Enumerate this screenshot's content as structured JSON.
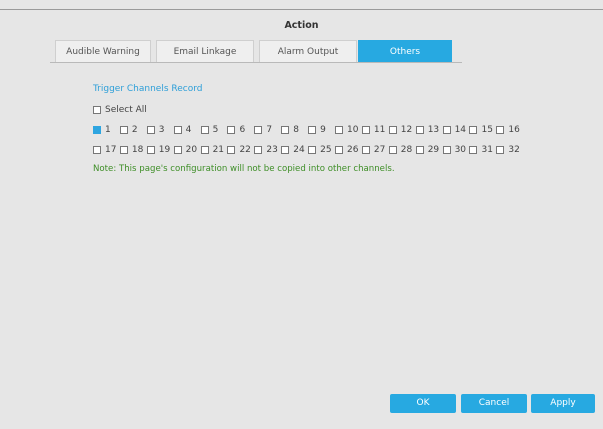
{
  "title": "Action",
  "tabs": [
    {
      "label": "Audible Warning",
      "active": false
    },
    {
      "label": "Email Linkage",
      "active": false
    },
    {
      "label": "Alarm Output",
      "active": false
    },
    {
      "label": "Others",
      "active": true
    }
  ],
  "section_title": "Trigger Channels Record",
  "select_all": {
    "label": "Select All",
    "checked": false
  },
  "channels_row1": [
    {
      "label": "1",
      "checked": true
    },
    {
      "label": "2",
      "checked": false
    },
    {
      "label": "3",
      "checked": false
    },
    {
      "label": "4",
      "checked": false
    },
    {
      "label": "5",
      "checked": false
    },
    {
      "label": "6",
      "checked": false
    },
    {
      "label": "7",
      "checked": false
    },
    {
      "label": "8",
      "checked": false
    },
    {
      "label": "9",
      "checked": false
    },
    {
      "label": "10",
      "checked": false
    },
    {
      "label": "11",
      "checked": false
    },
    {
      "label": "12",
      "checked": false
    },
    {
      "label": "13",
      "checked": false
    },
    {
      "label": "14",
      "checked": false
    },
    {
      "label": "15",
      "checked": false
    },
    {
      "label": "16",
      "checked": false
    }
  ],
  "channels_row2": [
    {
      "label": "17",
      "checked": false
    },
    {
      "label": "18",
      "checked": false
    },
    {
      "label": "19",
      "checked": false
    },
    {
      "label": "20",
      "checked": false
    },
    {
      "label": "21",
      "checked": false
    },
    {
      "label": "22",
      "checked": false
    },
    {
      "label": "23",
      "checked": false
    },
    {
      "label": "24",
      "checked": false
    },
    {
      "label": "25",
      "checked": false
    },
    {
      "label": "26",
      "checked": false
    },
    {
      "label": "27",
      "checked": false
    },
    {
      "label": "28",
      "checked": false
    },
    {
      "label": "29",
      "checked": false
    },
    {
      "label": "30",
      "checked": false
    },
    {
      "label": "31",
      "checked": false
    },
    {
      "label": "32",
      "checked": false
    }
  ],
  "note": "Note: This page's configuration will not be copied into other channels.",
  "buttons": {
    "ok": "OK",
    "cancel": "Cancel",
    "apply": "Apply"
  },
  "colors": {
    "accent": "#27a9e1",
    "note": "#3e8e27",
    "section": "#2e9fd8"
  }
}
